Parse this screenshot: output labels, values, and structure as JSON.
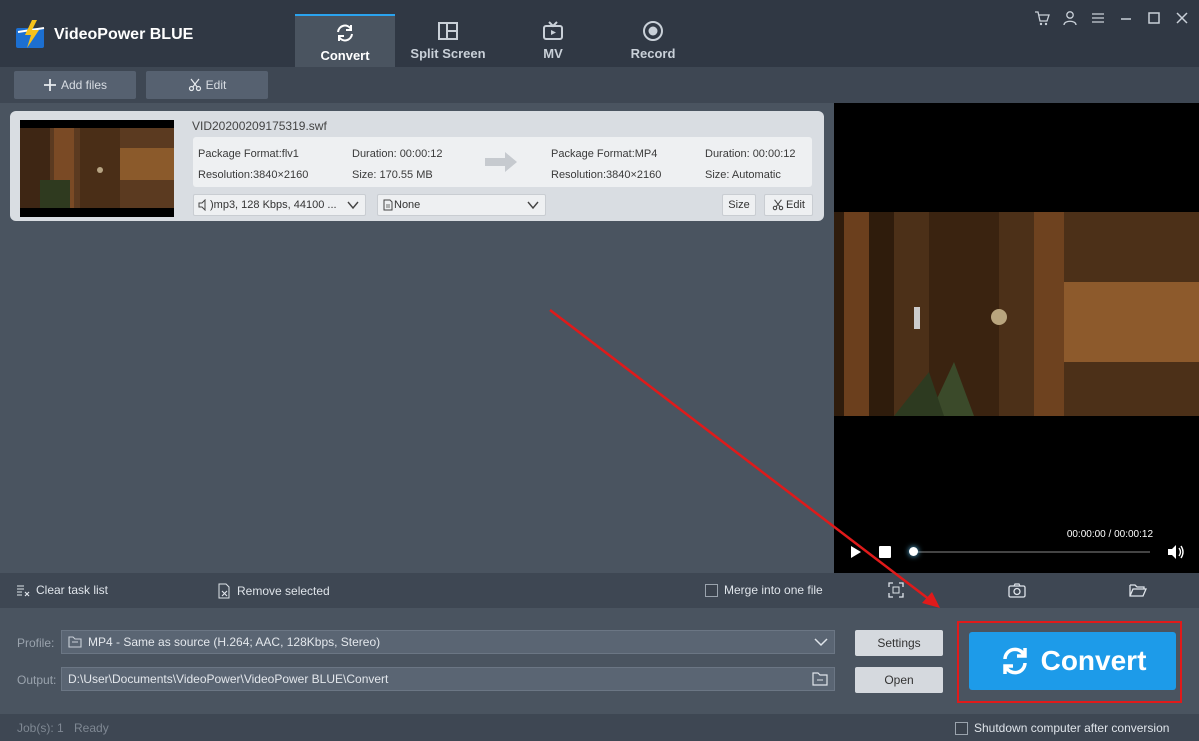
{
  "app": {
    "title": "VideoPower BLUE"
  },
  "tabs": [
    {
      "label": "Convert",
      "icon": "refresh-icon"
    },
    {
      "label": "Split Screen",
      "icon": "split-screen-icon"
    },
    {
      "label": "MV",
      "icon": "tv-icon"
    },
    {
      "label": "Record",
      "icon": "record-icon"
    }
  ],
  "toolbar": {
    "add_files": "Add files",
    "edit": "Edit"
  },
  "file": {
    "name": "VID20200209175319.swf",
    "src": {
      "format": "Package Format:flv1",
      "resolution": "Resolution:3840×2160",
      "duration": "Duration: 00:00:12",
      "size": "Size: 170.55 MB"
    },
    "dst": {
      "format": "Package Format:MP4",
      "resolution": "Resolution:3840×2160",
      "duration": "Duration: 00:00:12",
      "size": "Size: Automatic"
    },
    "audio": ")mp3, 128 Kbps, 44100 ...",
    "subtitle": "None",
    "size_btn": "Size",
    "edit_btn": "Edit"
  },
  "player": {
    "time": "00:00:00 / 00:00:12",
    "progress": 0.0
  },
  "tasks": {
    "clear": "Clear task list",
    "remove": "Remove selected",
    "merge": "Merge into one file"
  },
  "profile": {
    "label": "Profile:",
    "value": "MP4 - Same as source (H.264; AAC, 128Kbps, Stereo)",
    "settings": "Settings"
  },
  "output": {
    "label": "Output:",
    "value": "D:\\User\\Documents\\VideoPower\\VideoPower BLUE\\Convert",
    "open": "Open"
  },
  "convert_button": "Convert",
  "status": {
    "jobs": "Job(s): 1",
    "state": "Ready",
    "shutdown": "Shutdown computer after conversion"
  },
  "colors": {
    "accent": "#1d9be9",
    "highlight": "#e01a1a"
  }
}
